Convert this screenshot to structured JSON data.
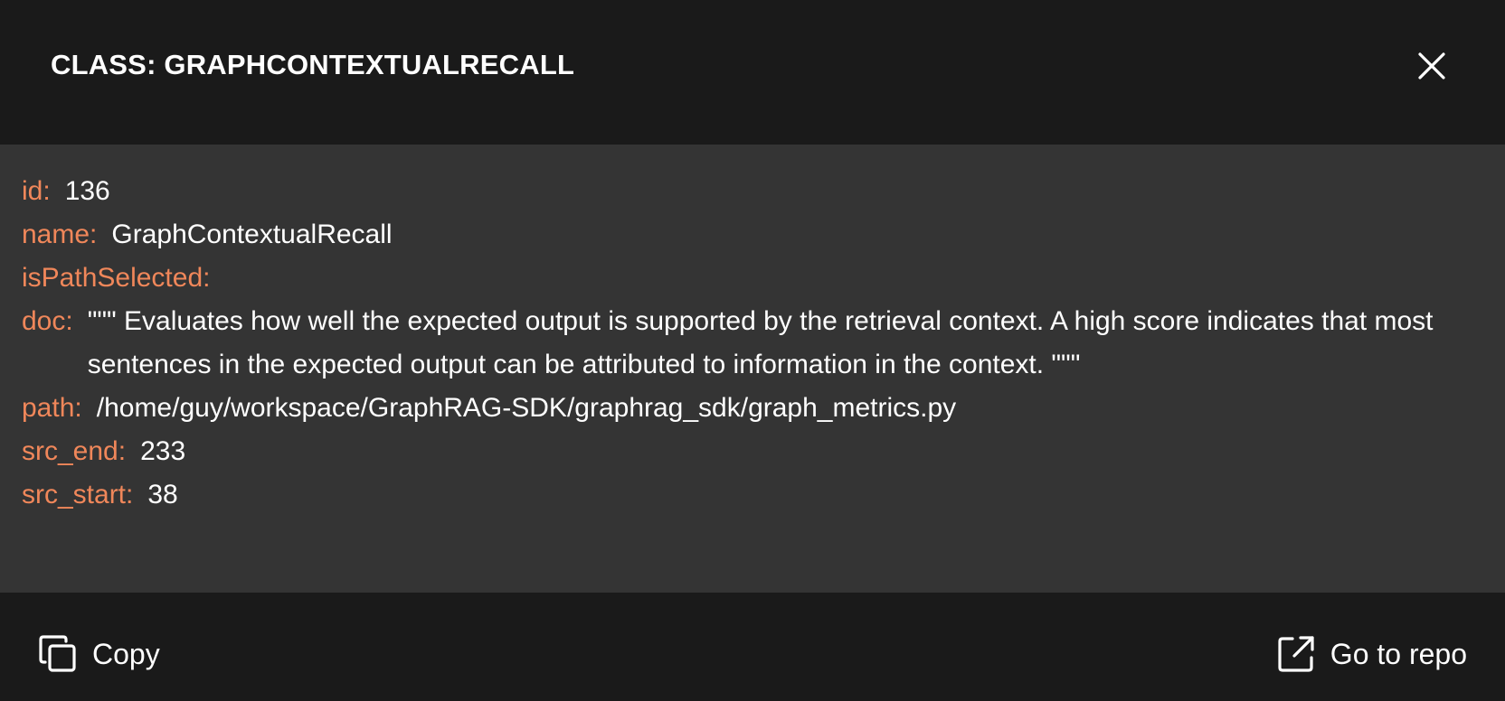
{
  "header": {
    "title": "CLASS: GRAPHCONTEXTUALRECALL",
    "close_icon": "close-icon"
  },
  "properties": [
    {
      "key": "id:",
      "value": "136"
    },
    {
      "key": "name:",
      "value": "GraphContextualRecall"
    },
    {
      "key": "isPathSelected:",
      "value": ""
    },
    {
      "key": "doc:",
      "value": "\"\"\" Evaluates how well the expected output is supported by the retrieval context. A high score indicates that most sentences in the expected output can be attributed to information in the context. \"\"\""
    },
    {
      "key": "path:",
      "value": "/home/guy/workspace/GraphRAG-SDK/graphrag_sdk/graph_metrics.py"
    },
    {
      "key": "src_end:",
      "value": "233"
    },
    {
      "key": "src_start:",
      "value": "38"
    }
  ],
  "footer": {
    "copy_label": "Copy",
    "copy_icon": "copy-icon",
    "repo_label": "Go to repo",
    "repo_icon": "external-link-icon"
  },
  "colors": {
    "key": "#f0875a",
    "value": "#ffffff",
    "header_bg": "#1a1a1a",
    "body_bg": "#343434"
  }
}
